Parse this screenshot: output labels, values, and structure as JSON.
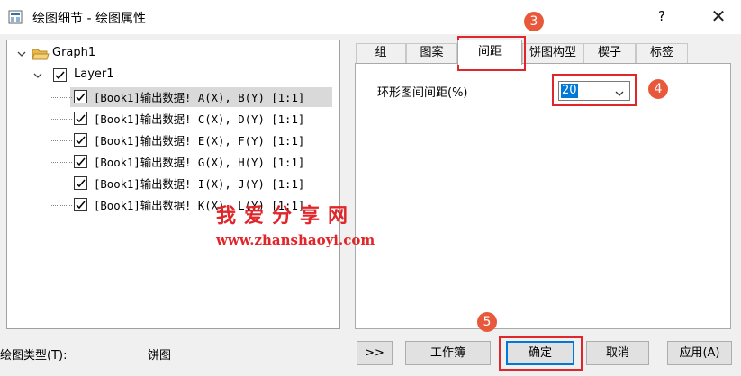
{
  "window": {
    "title": "绘图细节 - 绘图属性",
    "help_label": "?",
    "close_label": "✕"
  },
  "tree": {
    "graph_label": "Graph1",
    "layer_label": "Layer1",
    "plots": [
      {
        "label": "[Book1]输出数据! A(X), B(Y) [1:1]",
        "checked": true,
        "selected": true
      },
      {
        "label": "[Book1]输出数据! C(X), D(Y) [1:1]",
        "checked": true,
        "selected": false
      },
      {
        "label": "[Book1]输出数据! E(X), F(Y) [1:1]",
        "checked": true,
        "selected": false
      },
      {
        "label": "[Book1]输出数据! G(X), H(Y) [1:1]",
        "checked": true,
        "selected": false
      },
      {
        "label": "[Book1]输出数据! I(X), J(Y) [1:1]",
        "checked": true,
        "selected": false
      },
      {
        "label": "[Book1]输出数据! K(X), L(Y) [1:1]",
        "checked": true,
        "selected": false
      }
    ]
  },
  "tabs": [
    {
      "label": "组",
      "active": false
    },
    {
      "label": "图案",
      "active": false
    },
    {
      "label": "间距",
      "active": true
    },
    {
      "label": "饼图构型",
      "active": false
    },
    {
      "label": "楔子",
      "active": false
    },
    {
      "label": "标签",
      "active": false
    }
  ],
  "spacing": {
    "label": "环形图间间距(%)",
    "value": "20"
  },
  "annotations": [
    "3",
    "4",
    "5"
  ],
  "watermark": {
    "text": "我爱分享网",
    "url": "www.zhanshaoyi.com"
  },
  "footer": {
    "plot_type_label": "绘图类型(T):",
    "plot_type_value": "饼图",
    "expand_label": ">>",
    "workbook_label": "工作簿",
    "ok_label": "确定",
    "cancel_label": "取消",
    "apply_label": "应用(A)"
  },
  "colors": {
    "annotation_red": "#e0262a",
    "badge_orange": "#e8583a",
    "selection_blue": "#0078d7"
  }
}
